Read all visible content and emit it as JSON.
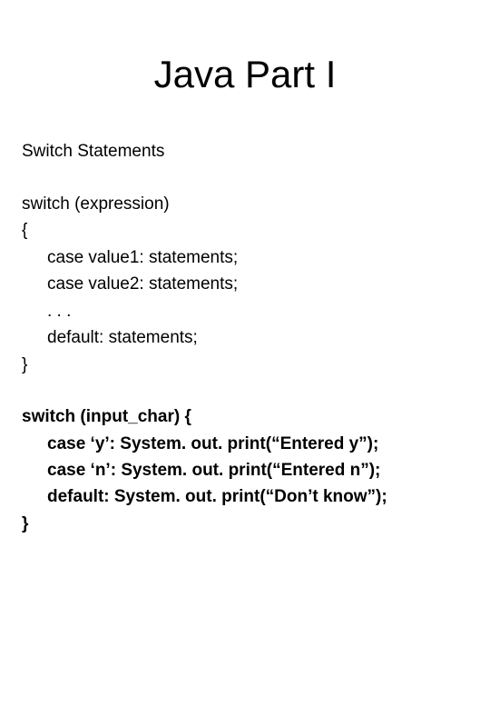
{
  "title": "Java Part I",
  "subtitle": "Switch Statements",
  "block1": {
    "l1": "switch (expression)",
    "l2": "{",
    "l3": "case value1: statements;",
    "l4": "case value2: statements;",
    "l5": ". . .",
    "l6": "default: statements;",
    "l7": "}"
  },
  "block2": {
    "l1": "switch (input_char) {",
    "l2": "case ‘y’: System. out. print(“Entered y”);",
    "l3": "case ‘n’: System. out. print(“Entered n”);",
    "l4": "default: System. out. print(“Don’t know”);",
    "l5": "}"
  }
}
